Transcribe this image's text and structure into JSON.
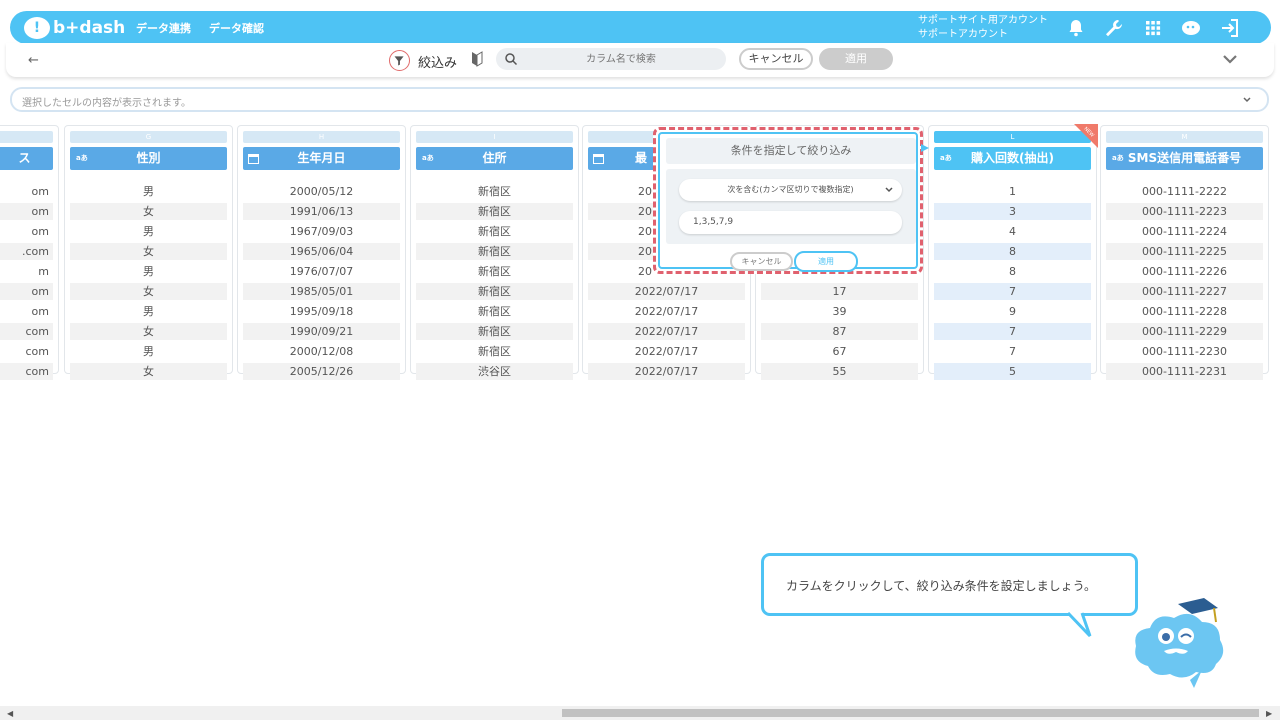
{
  "topbar": {
    "logo_text": "b+dash",
    "nav": [
      "データ連携",
      "データ確認"
    ],
    "account_line1": "サポートサイト用アカウント",
    "account_line2": "サポートアカウント",
    "icons": [
      "bell-icon",
      "wrench-icon",
      "grid-icon",
      "chat-bot-icon",
      "logout-icon"
    ]
  },
  "toolbar": {
    "back": "←",
    "filter_label": "絞込み",
    "search_placeholder": "カラム名で検索",
    "cancel": "キャンセル",
    "apply": "適用"
  },
  "cellbar": {
    "placeholder": "選択したセルの内容が表示されます。"
  },
  "columns": [
    {
      "letter": "",
      "name": "ス",
      "type": "",
      "cells": [
        "om",
        "om",
        "om",
        ".com",
        "m",
        "om",
        "om",
        "com",
        "com",
        "com"
      ]
    },
    {
      "letter": "G",
      "name": "性別",
      "type": "aあ",
      "cells": [
        "男",
        "女",
        "男",
        "女",
        "男",
        "女",
        "男",
        "女",
        "男",
        "女"
      ]
    },
    {
      "letter": "H",
      "name": "生年月日",
      "type": "date",
      "cells": [
        "2000/05/12",
        "1991/06/13",
        "1967/09/03",
        "1965/06/04",
        "1976/07/07",
        "1985/05/01",
        "1995/09/18",
        "1990/09/21",
        "2000/12/08",
        "2005/12/26"
      ]
    },
    {
      "letter": "I",
      "name": "住所",
      "type": "aあ",
      "cells": [
        "新宿区",
        "新宿区",
        "新宿区",
        "新宿区",
        "新宿区",
        "新宿区",
        "新宿区",
        "新宿区",
        "新宿区",
        "渋谷区"
      ]
    },
    {
      "letter": "",
      "name": "最",
      "type": "date",
      "cells": [
        "20",
        "20",
        "20",
        "20",
        "20",
        "2022/07/17",
        "2022/07/17",
        "2022/07/17",
        "2022/07/17",
        "2022/07/17"
      ]
    },
    {
      "letter": "",
      "name": "",
      "type": "",
      "cells": [
        "",
        "",
        "",
        "",
        "",
        "17",
        "39",
        "87",
        "67",
        "55"
      ]
    },
    {
      "letter": "L",
      "name": "購入回数(抽出)",
      "type": "aあ",
      "badge": "NEW",
      "cells": [
        "1",
        "3",
        "4",
        "8",
        "8",
        "7",
        "9",
        "7",
        "7",
        "5"
      ]
    },
    {
      "letter": "M",
      "name": "SMS送信用電話番号",
      "type": "aあ",
      "cells": [
        "000-1111-2222",
        "000-1111-2223",
        "000-1111-2224",
        "000-1111-2225",
        "000-1111-2226",
        "000-1111-2227",
        "000-1111-2228",
        "000-1111-2229",
        "000-1111-2230",
        "000-1111-2231"
      ]
    }
  ],
  "popup": {
    "title": "条件を指定して絞り込み",
    "condition": "次を含む(カンマ区切りで複数指定)",
    "value": "1,3,5,7,9",
    "cancel": "キャンセル",
    "apply": "適用"
  },
  "guide": {
    "message": "カラムをクリックして、絞り込み条件を設定しましょう。"
  },
  "colors": {
    "accent": "#4ec3f4",
    "header_blue": "#5aa9e6",
    "highlight_red": "#e0616e"
  }
}
